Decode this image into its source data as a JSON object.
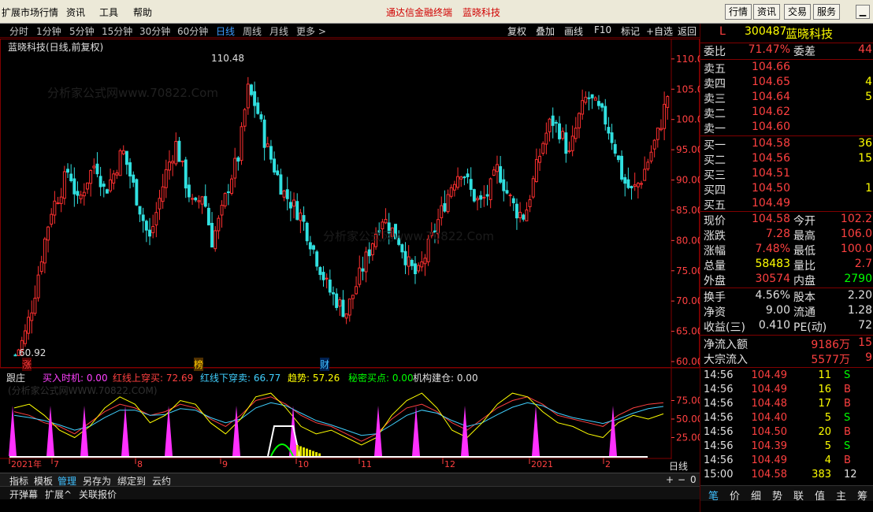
{
  "menubar": {
    "items": [
      "扩展市场行情",
      "资讯",
      "工具",
      "帮助"
    ],
    "center_title": "通达信金融终端",
    "center_stock": "蓝晓科技",
    "right_buttons": [
      "行情",
      "资讯",
      "交易",
      "服务"
    ]
  },
  "periodbar": {
    "periods": [
      "分时",
      "1分钟",
      "5分钟",
      "15分钟",
      "30分钟",
      "60分钟",
      "日线",
      "周线",
      "月线",
      "更多 >"
    ],
    "active": "日线",
    "tools": [
      "复权",
      "叠加",
      "画线",
      "F10",
      "标记",
      "+自选",
      "返回"
    ]
  },
  "chart": {
    "title": "蓝晓科技(日线,前复权)",
    "high_label": "110.48",
    "low_label": "60.92",
    "watermark": "分析家公式网www.70822.Com",
    "y_ticks": [
      "110.00",
      "105.00",
      "100.00",
      "95.00",
      "90.00",
      "85.00",
      "80.00",
      "75.00",
      "70.00",
      "65.00",
      "60.00"
    ],
    "markers": [
      "涨",
      "榜",
      "财"
    ],
    "x_ticks": [
      "2021年",
      "7",
      "8",
      "9",
      "10",
      "11",
      "12",
      "2021",
      "2"
    ],
    "period_label": "日线"
  },
  "indicator": {
    "name": "跟庄",
    "items": [
      {
        "label": "买入时机: 0.00",
        "color": "#ff40ff"
      },
      {
        "label": "红线上穿买: 72.69",
        "color": "#ff4040"
      },
      {
        "label": "红线下穿卖: 66.77",
        "color": "#40d0ff"
      },
      {
        "label": "趋势: 57.26",
        "color": "#ffff00"
      },
      {
        "label": "秘密买点: 0.00",
        "color": "#00ff00"
      },
      {
        "label": "机构建仓: 0.00",
        "color": "#e0e0e0"
      }
    ],
    "watermark": "(分析家公式网WWW.70822.COM)",
    "y_ticks": [
      "75.00",
      "50.00",
      "25.00"
    ]
  },
  "bottombar": [
    "指标",
    "模板",
    "管理",
    "另存为",
    "绑定到",
    "云约"
  ],
  "bottombar_right": [
    "+",
    "−",
    "0"
  ],
  "statusbar": [
    "开弹幕",
    "扩展^",
    "关联报价"
  ],
  "quote": {
    "letter": "L",
    "code": "300487",
    "name": "蓝晓科技",
    "weibi_label": "委比",
    "weibi": "71.47%",
    "weicha_label": "委差",
    "weicha": "44",
    "asks": [
      {
        "label": "卖五",
        "price": "104.66",
        "vol": ""
      },
      {
        "label": "卖四",
        "price": "104.65",
        "vol": "4"
      },
      {
        "label": "卖三",
        "price": "104.64",
        "vol": "5"
      },
      {
        "label": "卖二",
        "price": "104.62",
        "vol": ""
      },
      {
        "label": "卖一",
        "price": "104.60",
        "vol": ""
      }
    ],
    "bids": [
      {
        "label": "买一",
        "price": "104.58",
        "vol": "36"
      },
      {
        "label": "买二",
        "price": "104.56",
        "vol": "15"
      },
      {
        "label": "买三",
        "price": "104.51",
        "vol": ""
      },
      {
        "label": "买四",
        "price": "104.50",
        "vol": "1"
      },
      {
        "label": "买五",
        "price": "104.49",
        "vol": ""
      }
    ],
    "stats": [
      {
        "k1": "现价",
        "v1": "104.58",
        "c1": "#ff4040",
        "k2": "今开",
        "v2": "102.2",
        "c2": "#ff4040"
      },
      {
        "k1": "涨跌",
        "v1": "7.28",
        "c1": "#ff4040",
        "k2": "最高",
        "v2": "106.0",
        "c2": "#ff4040"
      },
      {
        "k1": "涨幅",
        "v1": "7.48%",
        "c1": "#ff4040",
        "k2": "最低",
        "v2": "100.0",
        "c2": "#ff4040"
      },
      {
        "k1": "总量",
        "v1": "58483",
        "c1": "#ffff00",
        "k2": "量比",
        "v2": "2.7",
        "c2": "#ff4040"
      },
      {
        "k1": "外盘",
        "v1": "30574",
        "c1": "#ff4040",
        "k2": "内盘",
        "v2": "2790",
        "c2": "#00ff00"
      }
    ],
    "stats2": [
      {
        "k1": "换手",
        "v1": "4.56%",
        "k2": "股本",
        "v2": "2.20"
      },
      {
        "k1": "净资",
        "v1": "9.00",
        "k2": "流通",
        "v2": "1.28"
      },
      {
        "k1": "收益(三)",
        "v1": "0.410",
        "k2": "PE(动)",
        "v2": "72"
      }
    ],
    "flows": [
      {
        "k": "净流入额",
        "v": "9186万",
        "v2": "15"
      },
      {
        "k": "大宗流入",
        "v": "5577万",
        "v2": "9"
      }
    ],
    "ticks": [
      {
        "t": "14:56",
        "p": "104.49",
        "v": "11",
        "s": "S"
      },
      {
        "t": "14:56",
        "p": "104.49",
        "v": "16",
        "s": "B"
      },
      {
        "t": "14:56",
        "p": "104.48",
        "v": "17",
        "s": "B"
      },
      {
        "t": "14:56",
        "p": "104.40",
        "v": "5",
        "s": "S"
      },
      {
        "t": "14:56",
        "p": "104.50",
        "v": "20",
        "s": "B"
      },
      {
        "t": "14:56",
        "p": "104.39",
        "v": "5",
        "s": "S"
      },
      {
        "t": "14:56",
        "p": "104.49",
        "v": "4",
        "s": "B"
      },
      {
        "t": "15:00",
        "p": "104.58",
        "v": "383",
        "s": "12"
      }
    ],
    "tabs": [
      "笔",
      "价",
      "细",
      "势",
      "联",
      "值",
      "主",
      "筹"
    ]
  },
  "chart_data": {
    "type": "candlestick",
    "title": "蓝晓科技(日线,前复权)",
    "ylim": [
      60,
      110.5
    ],
    "x_ticks": [
      "2021年",
      "7",
      "8",
      "9",
      "10",
      "11",
      "12",
      "2021",
      "2"
    ],
    "close_path": [
      61,
      64,
      70,
      78,
      85,
      88,
      92,
      86,
      90,
      93,
      88,
      91,
      95,
      90,
      85,
      80,
      86,
      92,
      96,
      90,
      85,
      88,
      80,
      84,
      90,
      94,
      105,
      102,
      96,
      92,
      88,
      86,
      84,
      80,
      76,
      72,
      70,
      68,
      72,
      76,
      80,
      84,
      82,
      80,
      76,
      74,
      78,
      82,
      86,
      90,
      92,
      88,
      86,
      88,
      92,
      88,
      85,
      84,
      90,
      96,
      100,
      98,
      94,
      100,
      104,
      102,
      100,
      96,
      90,
      88,
      90,
      94,
      98,
      104
    ],
    "indicator_ylim": [
      0,
      100
    ],
    "indicator_series": [
      {
        "name": "红线上穿买",
        "color": "#ff4040",
        "values": [
          60,
          55,
          45,
          40,
          30,
          45,
          60,
          70,
          65,
          55,
          60,
          70,
          65,
          50,
          40,
          55,
          75,
          80,
          70,
          55,
          45,
          40,
          30,
          20,
          30,
          50,
          65,
          70,
          60,
          45,
          35,
          50,
          65,
          75,
          80,
          70,
          55,
          50,
          45,
          40,
          55,
          65,
          70,
          72
        ]
      },
      {
        "name": "红线下穿卖",
        "color": "#40d0ff",
        "values": [
          55,
          52,
          48,
          42,
          35,
          40,
          52,
          62,
          62,
          55,
          56,
          64,
          62,
          52,
          45,
          50,
          65,
          72,
          68,
          58,
          48,
          42,
          35,
          28,
          30,
          42,
          55,
          62,
          58,
          48,
          40,
          45,
          56,
          66,
          72,
          68,
          58,
          52,
          48,
          44,
          50,
          58,
          64,
          67
        ]
      },
      {
        "name": "趋势",
        "color": "#ffff00",
        "values": [
          65,
          70,
          55,
          35,
          25,
          40,
          65,
          80,
          70,
          45,
          55,
          75,
          70,
          45,
          30,
          50,
          80,
          85,
          65,
          40,
          30,
          35,
          25,
          15,
          25,
          55,
          75,
          85,
          65,
          35,
          25,
          45,
          70,
          85,
          80,
          60,
          45,
          40,
          30,
          25,
          45,
          55,
          50,
          57
        ]
      }
    ]
  }
}
